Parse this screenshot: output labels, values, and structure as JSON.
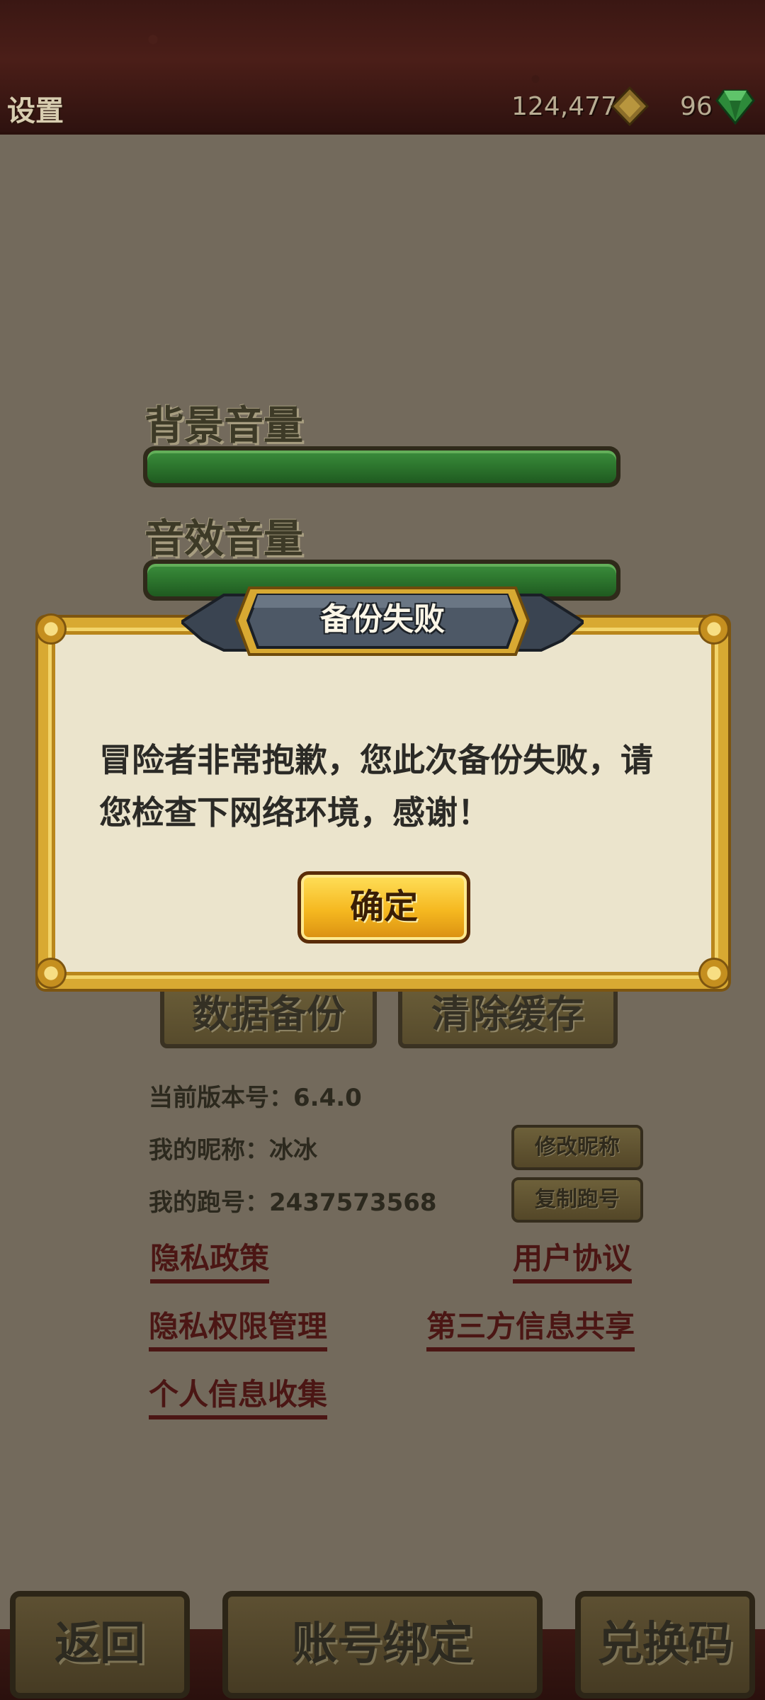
{
  "header": {
    "title": "设置",
    "gold": "124,477",
    "gems": "96"
  },
  "settings": {
    "bgm_label": "背景音量",
    "bgm_level": 1.0,
    "sfx_label": "音效音量",
    "sfx_level": 1.0,
    "backup_button": "数据备份",
    "clear_cache_button": "清除缓存",
    "version_text": "当前版本号：6.4.0",
    "nickname_text": "我的昵称：冰冰",
    "run_id_text": "我的跑号：2437573568",
    "edit_nickname_button": "修改昵称",
    "copy_id_button": "复制跑号",
    "links": {
      "privacy_policy": "隐私政策",
      "user_agreement": "用户协议",
      "privacy_permission": "隐私权限管理",
      "third_party_sharing": "第三方信息共享",
      "personal_info": "个人信息收集"
    }
  },
  "bottom": {
    "back": "返回",
    "bind_account": "账号绑定",
    "redeem": "兑换码"
  },
  "dialog": {
    "title": "备份失败",
    "message": "冒险者非常抱歉，您此次备份失败，请您检查下网络环境，感谢！",
    "confirm": "确定"
  },
  "colors": {
    "gold_border": "#d8a932",
    "ok_button": "#f5b820",
    "link": "#4b1614",
    "slider_fill": "#2f7a30"
  }
}
